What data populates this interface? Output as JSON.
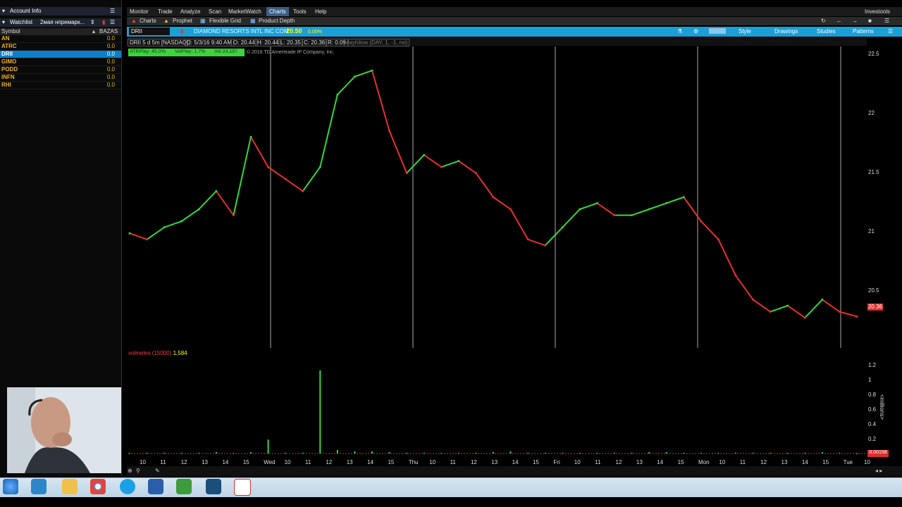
{
  "account": {
    "title": "Account Info"
  },
  "watchlist": {
    "title": "Watchlist",
    "name": "2мая нпремарк...",
    "col_symbol": "Symbol",
    "col_value": "BAZAS",
    "rows": [
      {
        "symbol": "AN",
        "value": "0.0"
      },
      {
        "symbol": "ATRC",
        "value": "0.0"
      },
      {
        "symbol": "DRII",
        "value": "0.0"
      },
      {
        "symbol": "GIMO",
        "value": "0.0"
      },
      {
        "symbol": "PODD",
        "value": "0.0"
      },
      {
        "symbol": "INFN",
        "value": "0.0"
      },
      {
        "symbol": "RHI",
        "value": "0.0"
      }
    ]
  },
  "menu": {
    "items": [
      "Monitor",
      "Trade",
      "Analyze",
      "Scan",
      "MarketWatch",
      "Charts",
      "Tools",
      "Help"
    ],
    "right": "Investools"
  },
  "subtabs": {
    "charts": "Charts",
    "prophet": "Prophet",
    "flexible_grid": "Flexible Grid",
    "product_depth": "Product Depth"
  },
  "chartbar": {
    "symbol": "DRII",
    "name": "DIAMOND RESORTS INTL INC COM",
    "price": "20.50",
    "change": "0.00%",
    "style": "Style",
    "drawings": "Drawings",
    "studies": "Studies",
    "patterns": "Patterns"
  },
  "infobar": {
    "desc": "DRII 5 d 5m [NASDAQ]",
    "date": "D: 5/3/16 9:40 AM",
    "open": "O: 20.44",
    "high": "H: 20.44",
    "low": "L: 20.35",
    "close": "C: 20.36",
    "range": "R: 0.09",
    "study": "dayhilow (DAY, 1, -1, no)"
  },
  "studies": {
    "atr": "ATRPlay: 45.0%",
    "vol": "VolPlay: 1.7%",
    "volcount": "Vol 24,197"
  },
  "copyright": "© 2016 TD Ameritrade IP Company, Inc.",
  "price_axis": {
    "ticks": [
      "22.5",
      "22",
      "21.5",
      "21",
      "20.5"
    ],
    "current": "20.36"
  },
  "volume": {
    "label": "volmeles (15000)",
    "value": "1,584",
    "ticks": [
      "1.2",
      "1",
      "0.8",
      "0.6",
      "0.4",
      "0.2"
    ],
    "unit": "<millions>",
    "current": "0.00158"
  },
  "x_axis": {
    "labels": [
      "10",
      "11",
      "12",
      "13",
      "14",
      "15",
      "Wed",
      "10",
      "11",
      "12",
      "13",
      "14",
      "15",
      "Thu",
      "10",
      "11",
      "12",
      "13",
      "14",
      "15",
      "Fri",
      "10",
      "11",
      "12",
      "13",
      "14",
      "15",
      "Mon",
      "10",
      "11",
      "12",
      "13",
      "14",
      "15",
      "Tue",
      "10"
    ]
  },
  "colors": {
    "up": "#39d639",
    "down": "#e53030",
    "accent": "#1a9fd8",
    "tag": "#d9302c"
  },
  "chart_data": {
    "type": "line",
    "title": "DRII 5 d 5m [NASDAQ]",
    "xlabel": "",
    "ylabel": "",
    "ylim": [
      20.1,
      22.6
    ],
    "days": [
      "Tue",
      "Wed",
      "Thu",
      "Fri",
      "Mon",
      "Tue"
    ],
    "x": [
      "Tue 9:30",
      "Tue 11",
      "Tue 13",
      "Tue 15",
      "Tue 15:55",
      "Wed 9:35",
      "Wed 10",
      "Wed 10:30",
      "Wed 11",
      "Wed 12",
      "Wed 13",
      "Wed 14",
      "Wed 15",
      "Wed 15:55",
      "Thu 9:35",
      "Thu 10",
      "Thu 10:30",
      "Thu 11",
      "Thu 12",
      "Thu 13",
      "Thu 14",
      "Thu 15",
      "Thu 15:55",
      "Fri 9:35",
      "Fri 10",
      "Fri 10:30",
      "Fri 11",
      "Fri 12",
      "Fri 13",
      "Fri 14",
      "Fri 15",
      "Fri 15:55",
      "Mon 9:35",
      "Mon 10",
      "Mon 10:30",
      "Mon 11",
      "Mon 12",
      "Mon 13",
      "Mon 14",
      "Mon 15",
      "Mon 15:55",
      "Tue 9:35",
      "Tue 9:40"
    ],
    "series": [
      {
        "values": [
          21.05,
          21.0,
          21.1,
          21.15,
          21.25,
          21.4,
          21.2,
          21.85,
          21.6,
          21.5,
          21.4,
          21.6,
          22.2,
          22.35,
          22.4,
          21.9,
          21.55,
          21.7,
          21.6,
          21.65,
          21.55,
          21.35,
          21.25,
          21.0,
          20.95,
          21.1,
          21.25,
          21.3,
          21.2,
          21.2,
          21.25,
          21.3,
          21.35,
          21.15,
          21.0,
          20.7,
          20.5,
          20.4,
          20.45,
          20.35,
          20.5,
          20.4,
          20.36
        ]
      }
    ],
    "volume": [
      0.01,
      0.01,
      0.01,
      0.01,
      0.01,
      0.02,
      0.01,
      0.02,
      0.2,
      0.01,
      0.01,
      1.2,
      0.05,
      0.03,
      0.03,
      0.02,
      0.01,
      0.01,
      0.01,
      0.01,
      0.01,
      0.02,
      0.03,
      0.01,
      0.01,
      0.01,
      0.01,
      0.01,
      0.01,
      0.01,
      0.02,
      0.02,
      0.01,
      0.01,
      0.01,
      0.01,
      0.01,
      0.01,
      0.01,
      0.01,
      0.02,
      0.01,
      0.00158
    ]
  },
  "webcam": {
    "kind": "webcam-overlay"
  }
}
